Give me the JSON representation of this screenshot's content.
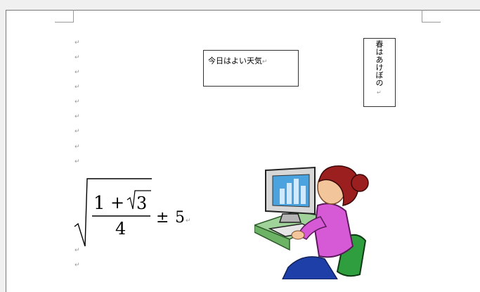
{
  "document": {
    "paragraph_mark": "↵",
    "textbox_horizontal": "今日はよい天気",
    "textbox_vertical": "春はあけぼの",
    "equation": {
      "numerator": "1 + √3",
      "one": "1",
      "plus": "+",
      "sqrt_arg": "3",
      "denominator": "4",
      "pm": "±",
      "constant": "5"
    }
  },
  "illustration": {
    "name": "woman-at-computer-clipart"
  },
  "colors": {
    "page": "#ffffff",
    "workspace": "#f0f0f0",
    "crop_marks": "#9a9a9a"
  }
}
